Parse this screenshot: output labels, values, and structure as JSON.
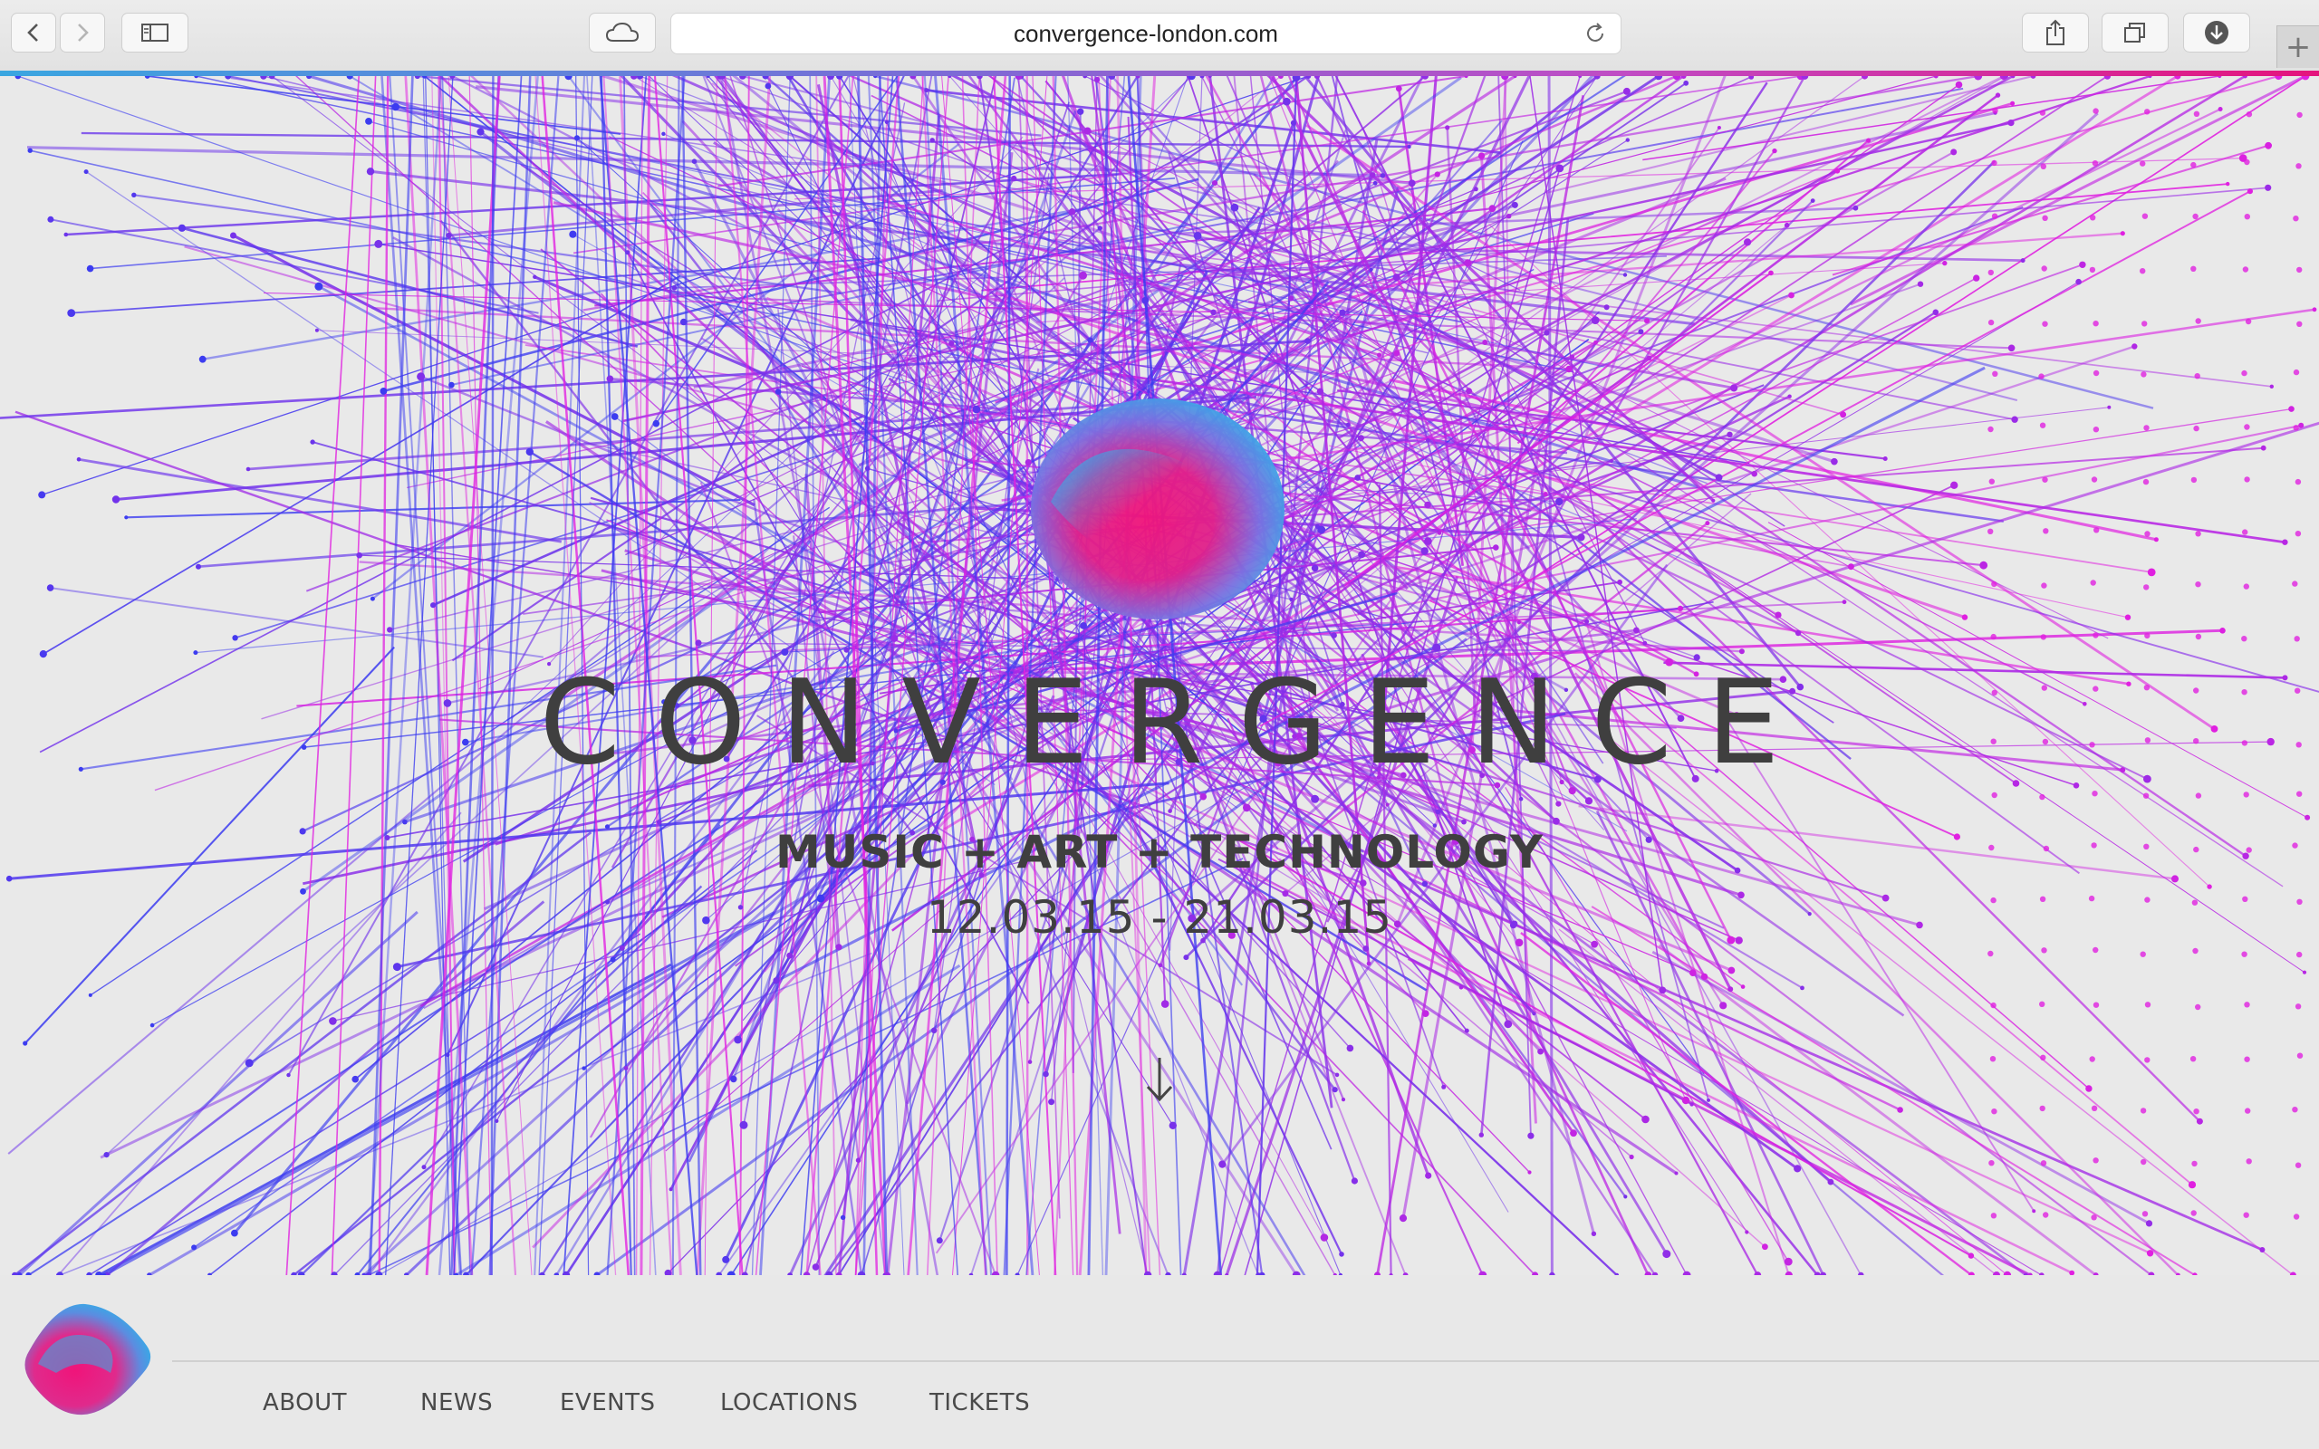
{
  "browser": {
    "url": "convergence-london.com"
  },
  "hero": {
    "title": "CONVERGENCE",
    "subtitle": "MUSIC + ART + TECHNOLOGY",
    "dates": "12.03.15 - 21.03.15"
  },
  "nav": {
    "items": [
      {
        "label": "ABOUT"
      },
      {
        "label": "NEWS"
      },
      {
        "label": "EVENTS"
      },
      {
        "label": "LOCATIONS"
      },
      {
        "label": "TICKETS"
      }
    ]
  },
  "colors": {
    "blue": "#3c3cf0",
    "magenta": "#e020e0",
    "cyan": "#2fb0e8",
    "pink": "#f0147a",
    "text": "#3f3f3f"
  }
}
